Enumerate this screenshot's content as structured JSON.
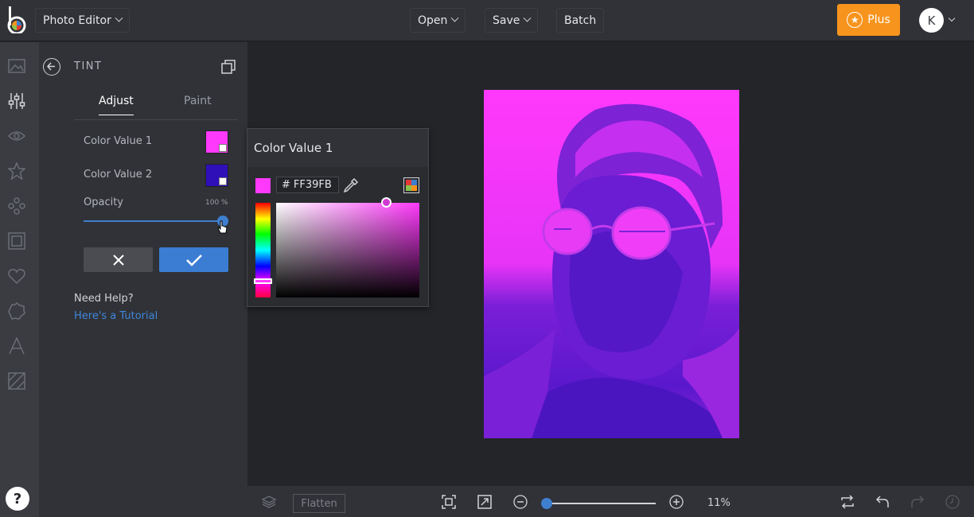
{
  "topbar": {
    "app_menu_label": "Photo Editor",
    "open_label": "Open",
    "save_label": "Save",
    "batch_label": "Batch",
    "plus_label": "Plus",
    "avatar_initial": "K"
  },
  "rail": {
    "icons": [
      "image-icon",
      "sliders-icon",
      "eye-icon",
      "star-icon",
      "shapes-icon",
      "frame-icon",
      "heart-icon",
      "badge-icon",
      "text-icon",
      "texture-icon"
    ],
    "help_label": "?"
  },
  "panel": {
    "title": "TINT",
    "tabs": [
      "Adjust",
      "Paint"
    ],
    "color1_label": "Color Value 1",
    "color1_hex": "#FF39FB",
    "color2_label": "Color Value 2",
    "color2_hex": "#2F0FB8",
    "opacity_label": "Opacity",
    "opacity_value": "100 %",
    "opacity_fraction": 1.0,
    "help_title": "Need Help?",
    "help_link": "Here's a Tutorial"
  },
  "picker": {
    "title": "Color Value 1",
    "hex_prefix": "#",
    "hex_value": "FF39FB",
    "current_color": "#FF39FB"
  },
  "bottombar": {
    "flatten_label": "Flatten",
    "zoom_value": "11%",
    "zoom_minus": "−",
    "zoom_plus": "+"
  },
  "colors": {
    "accent": "#3F7FD0",
    "plus": "#F7941D",
    "tint_magenta": "#FF39FB",
    "tint_violet": "#2F0FB8"
  }
}
